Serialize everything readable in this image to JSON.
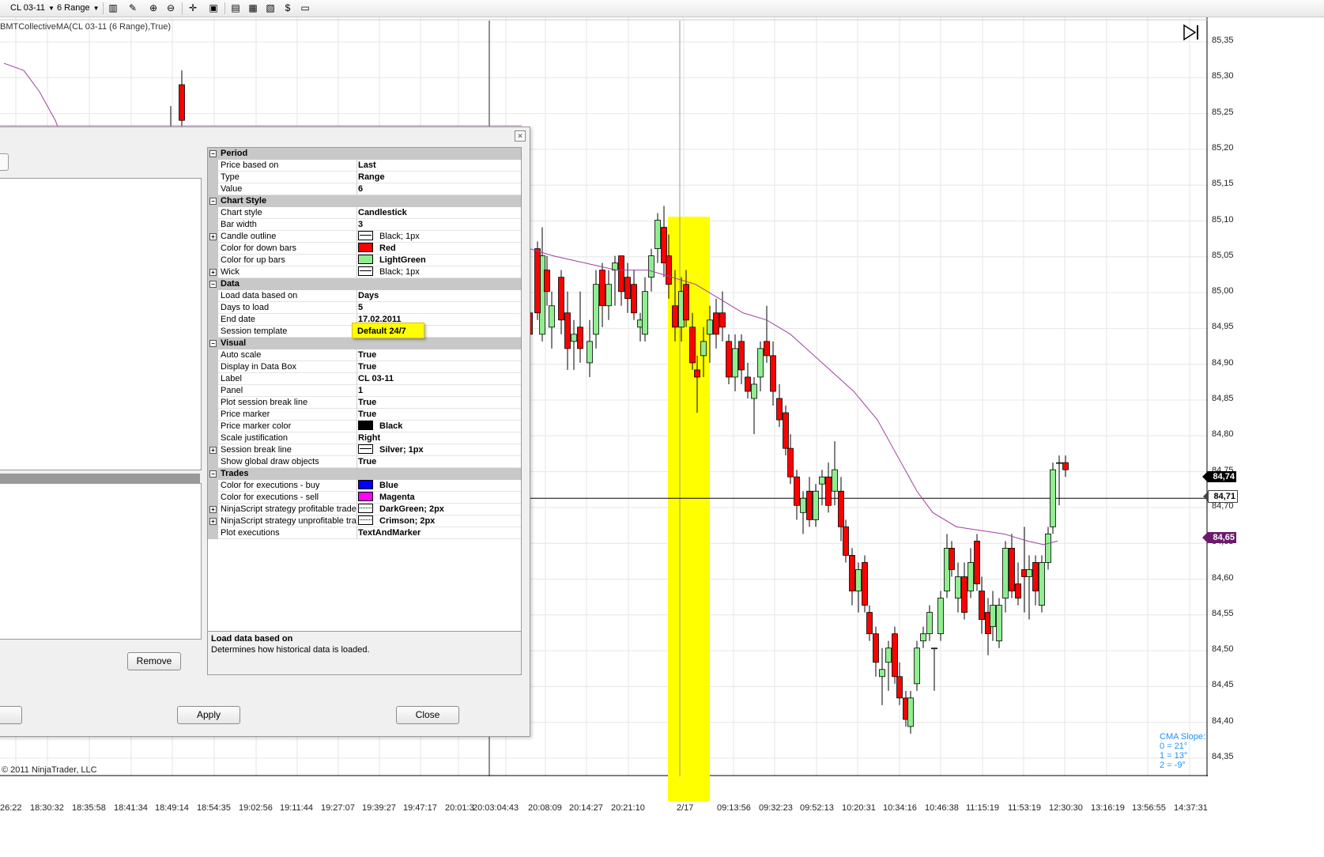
{
  "toolbar": {
    "instrument": "CL 03-11",
    "period": "6 Range"
  },
  "indicator_label": "BMTCollectiveMA(CL 03-11 (6 Range),True)",
  "copyright": "© 2011 NinjaTrader, LLC",
  "cma": {
    "title": "CMA Slope:",
    "lines": [
      "0 = 21°",
      "1 = 13°",
      "2 = -9°"
    ]
  },
  "price_axis": {
    "ticks": [
      "85,35",
      "85,30",
      "85,25",
      "85,20",
      "85,15",
      "85,10",
      "85,05",
      "85,00",
      "84,95",
      "84,90",
      "84,85",
      "84,80",
      "84,75",
      "84,70",
      "84,65",
      "84,60",
      "84,55",
      "84,50",
      "84,45",
      "84,40",
      "84,35"
    ],
    "current_price": "84,74",
    "line_price": "84,71",
    "ma_price": "84,65"
  },
  "time_axis": {
    "ticks": [
      "26:22",
      "18:30:32",
      "18:35:58",
      "18:41:34",
      "18:49:14",
      "18:54:35",
      "19:02:56",
      "19:11:44",
      "19:27:07",
      "19:39:27",
      "19:47:17",
      "20:01:3",
      "20:03:04:43",
      "20:08:09",
      "20:14:27",
      "20:21:10",
      "2/17",
      "09:13:56",
      "09:32:23",
      "09:52:13",
      "10:20:31",
      "10:34:16",
      "10:46:38",
      "11:15:19",
      "11:53:19",
      "12:30:30",
      "13:16:19",
      "13:56:55",
      "14:37:31"
    ]
  },
  "chart_data": {
    "type": "candlestick",
    "instrument": "CL 03-11",
    "period": "6 Range",
    "ylim": [
      84.33,
      85.38
    ],
    "moving_average": "BMTCollectiveMA",
    "highlight": "2/17",
    "horizontal_line": 84.71,
    "colors": {
      "up": "#90ee90",
      "down": "#ff0000",
      "ma": "#a040a0",
      "highlight": "#ffff00"
    }
  },
  "dialog": {
    "buttons": {
      "remove": "Remove",
      "apply": "Apply",
      "close": "Close"
    },
    "properties": [
      {
        "kind": "cat",
        "name": "Period"
      },
      {
        "kind": "prop",
        "name": "Price based on",
        "value": "Last"
      },
      {
        "kind": "prop",
        "name": "Type",
        "value": "Range"
      },
      {
        "kind": "prop",
        "name": "Value",
        "value": "6"
      },
      {
        "kind": "cat",
        "name": "Chart Style"
      },
      {
        "kind": "prop",
        "name": "Chart style",
        "value": "Candlestick"
      },
      {
        "kind": "prop",
        "name": "Bar width",
        "value": "3"
      },
      {
        "kind": "prop",
        "name": "Candle outline",
        "value": "Black; 1px",
        "swatch": "line",
        "expand": true,
        "plain": true
      },
      {
        "kind": "prop",
        "name": "Color for down bars",
        "value": "Red",
        "swatch": "#ff0000"
      },
      {
        "kind": "prop",
        "name": "Color for up bars",
        "value": "LightGreen",
        "swatch": "#90ee90"
      },
      {
        "kind": "prop",
        "name": "Wick",
        "value": "Black; 1px",
        "swatch": "line",
        "expand": true,
        "plain": true
      },
      {
        "kind": "cat",
        "name": "Data"
      },
      {
        "kind": "prop",
        "name": "Load data based on",
        "value": "Days"
      },
      {
        "kind": "prop",
        "name": "Days to load",
        "value": "5"
      },
      {
        "kind": "prop",
        "name": "End date",
        "value": "17.02.2011"
      },
      {
        "kind": "prop",
        "name": "Session template",
        "value": ""
      },
      {
        "kind": "cat",
        "name": "Visual"
      },
      {
        "kind": "prop",
        "name": "Auto scale",
        "value": "True"
      },
      {
        "kind": "prop",
        "name": "Display in Data Box",
        "value": "True"
      },
      {
        "kind": "prop",
        "name": "Label",
        "value": "CL 03-11"
      },
      {
        "kind": "prop",
        "name": "Panel",
        "value": "1"
      },
      {
        "kind": "prop",
        "name": "Plot session break line",
        "value": "True"
      },
      {
        "kind": "prop",
        "name": "Price marker",
        "value": "True"
      },
      {
        "kind": "prop",
        "name": "Price marker color",
        "value": "Black",
        "swatch": "#000000"
      },
      {
        "kind": "prop",
        "name": "Scale justification",
        "value": "Right"
      },
      {
        "kind": "prop",
        "name": "Session break line",
        "value": "Silver; 1px",
        "swatch": "line",
        "expand": true
      },
      {
        "kind": "prop",
        "name": "Show global draw objects",
        "value": "True"
      },
      {
        "kind": "cat",
        "name": "Trades"
      },
      {
        "kind": "prop",
        "name": "Color for executions - buy",
        "value": "Blue",
        "swatch": "#0000ff"
      },
      {
        "kind": "prop",
        "name": "Color for executions - sell",
        "value": "Magenta",
        "swatch": "#ff00ff"
      },
      {
        "kind": "prop",
        "name": "NinjaScript strategy profitable trade li",
        "value": "DarkGreen; 2px",
        "swatch": "dot",
        "expand": true
      },
      {
        "kind": "prop",
        "name": "NinjaScript strategy unprofitable trade",
        "value": "Crimson; 2px",
        "swatch": "dot",
        "expand": true
      },
      {
        "kind": "prop",
        "name": "Plot executions",
        "value": "TextAndMarker"
      }
    ],
    "session_template_value": "Default 24/7",
    "description": {
      "title": "Load data based on",
      "text": "Determines how historical data is loaded."
    }
  }
}
